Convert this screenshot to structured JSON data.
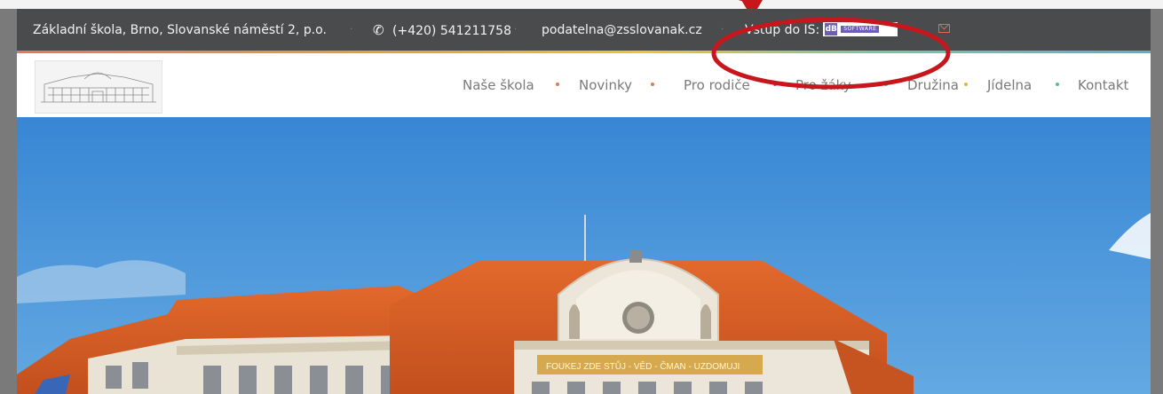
{
  "contact_bar": {
    "school_name": "Základní škola, Brno, Slovanské náměstí 2, p.o.",
    "phone": "(+420) 541211758",
    "email": "podatelna@zsslovanak.cz",
    "is_label": "Vstup do IS:",
    "is_logo_text": "SOFTWARE",
    "is_logo_mark": "dB",
    "separator": "·"
  },
  "nav": {
    "items": [
      {
        "label": "Naše škola",
        "dot_color": "#e07a5f"
      },
      {
        "label": "Novinky",
        "dot_color": "#e07a5f"
      },
      {
        "label": "Pro rodiče",
        "dot_color": "#e0455a"
      },
      {
        "label": "Pro žáky",
        "dot_color": "#5db0c9"
      },
      {
        "label": "Družina",
        "dot_color": "#e6b63c"
      },
      {
        "label": "Jídelna",
        "dot_color": "#5cbf8a"
      },
      {
        "label": "Kontakt",
        "dot_color": null
      }
    ]
  },
  "hero": {
    "building_inscription": "FOUKEJ ZDE STŮJ - VĚD - ČMAN - UZDOMUJI"
  },
  "colors": {
    "contact_bg": "#4a4b4d",
    "accent_red": "#c8161d",
    "sky": "#3f8fd6"
  },
  "icons": {
    "phone": "phone-icon",
    "mail": "mail-icon"
  }
}
